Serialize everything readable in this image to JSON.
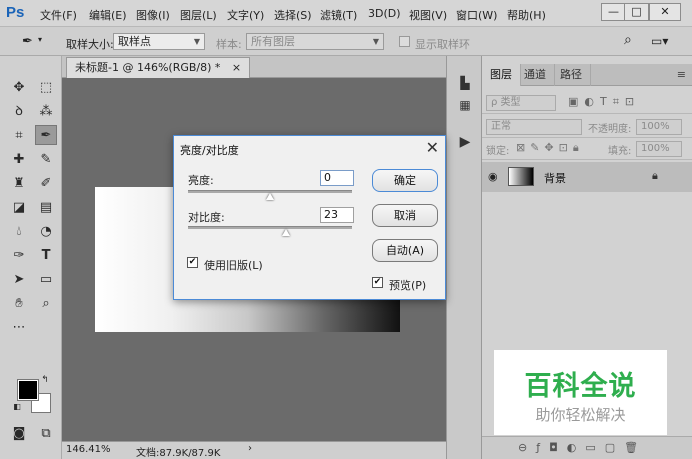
{
  "app": {
    "logo": "Ps"
  },
  "menu": {
    "items": [
      "文件(F)",
      "编辑(E)",
      "图像(I)",
      "图层(L)",
      "文字(Y)",
      "选择(S)",
      "滤镜(T)",
      "3D(D)",
      "视图(V)",
      "窗口(W)",
      "帮助(H)"
    ]
  },
  "window_controls": {
    "minimize": "—",
    "maximize": "□",
    "close": "✕"
  },
  "options": {
    "sample_size_label": "取样大小:",
    "sample_size_value": "取样点",
    "sample_label": "样本:",
    "sample_value": "所有图层",
    "show_ring_label": "显示取样环"
  },
  "document": {
    "tab_title": "未标题-1 @ 146%(RGB/8) *",
    "tab_close": "×",
    "zoom": "146.41%",
    "doc_info": "文档:87.9K/87.9K",
    "status_arrow": "›"
  },
  "dialog": {
    "title": "亮度/对比度",
    "brightness_label": "亮度:",
    "brightness_value": "0",
    "contrast_label": "对比度:",
    "contrast_value": "23",
    "brightness_slider": 0.5,
    "contrast_slider": 0.6,
    "legacy_label": "使用旧版(L)",
    "legacy_checked": true,
    "ok_label": "确定",
    "cancel_label": "取消",
    "auto_label": "自动(A)",
    "preview_label": "预览(P)",
    "preview_checked": true
  },
  "layers_panel": {
    "tabs": [
      "图层",
      "通道",
      "路径"
    ],
    "filter_label": "ρ 类型",
    "blend_mode": "正常",
    "opacity_label": "不透明度:",
    "opacity_value": "100%",
    "lock_label": "锁定:",
    "fill_label": "填充:",
    "fill_value": "100%",
    "layer_name": "背景"
  },
  "watermark": {
    "title": "百科全说",
    "subtitle": "助你轻松解决"
  },
  "colors": {
    "accent": "#4b8ad6",
    "watermark_green": "#2fae4e",
    "ps_blue": "#1b64b8"
  }
}
